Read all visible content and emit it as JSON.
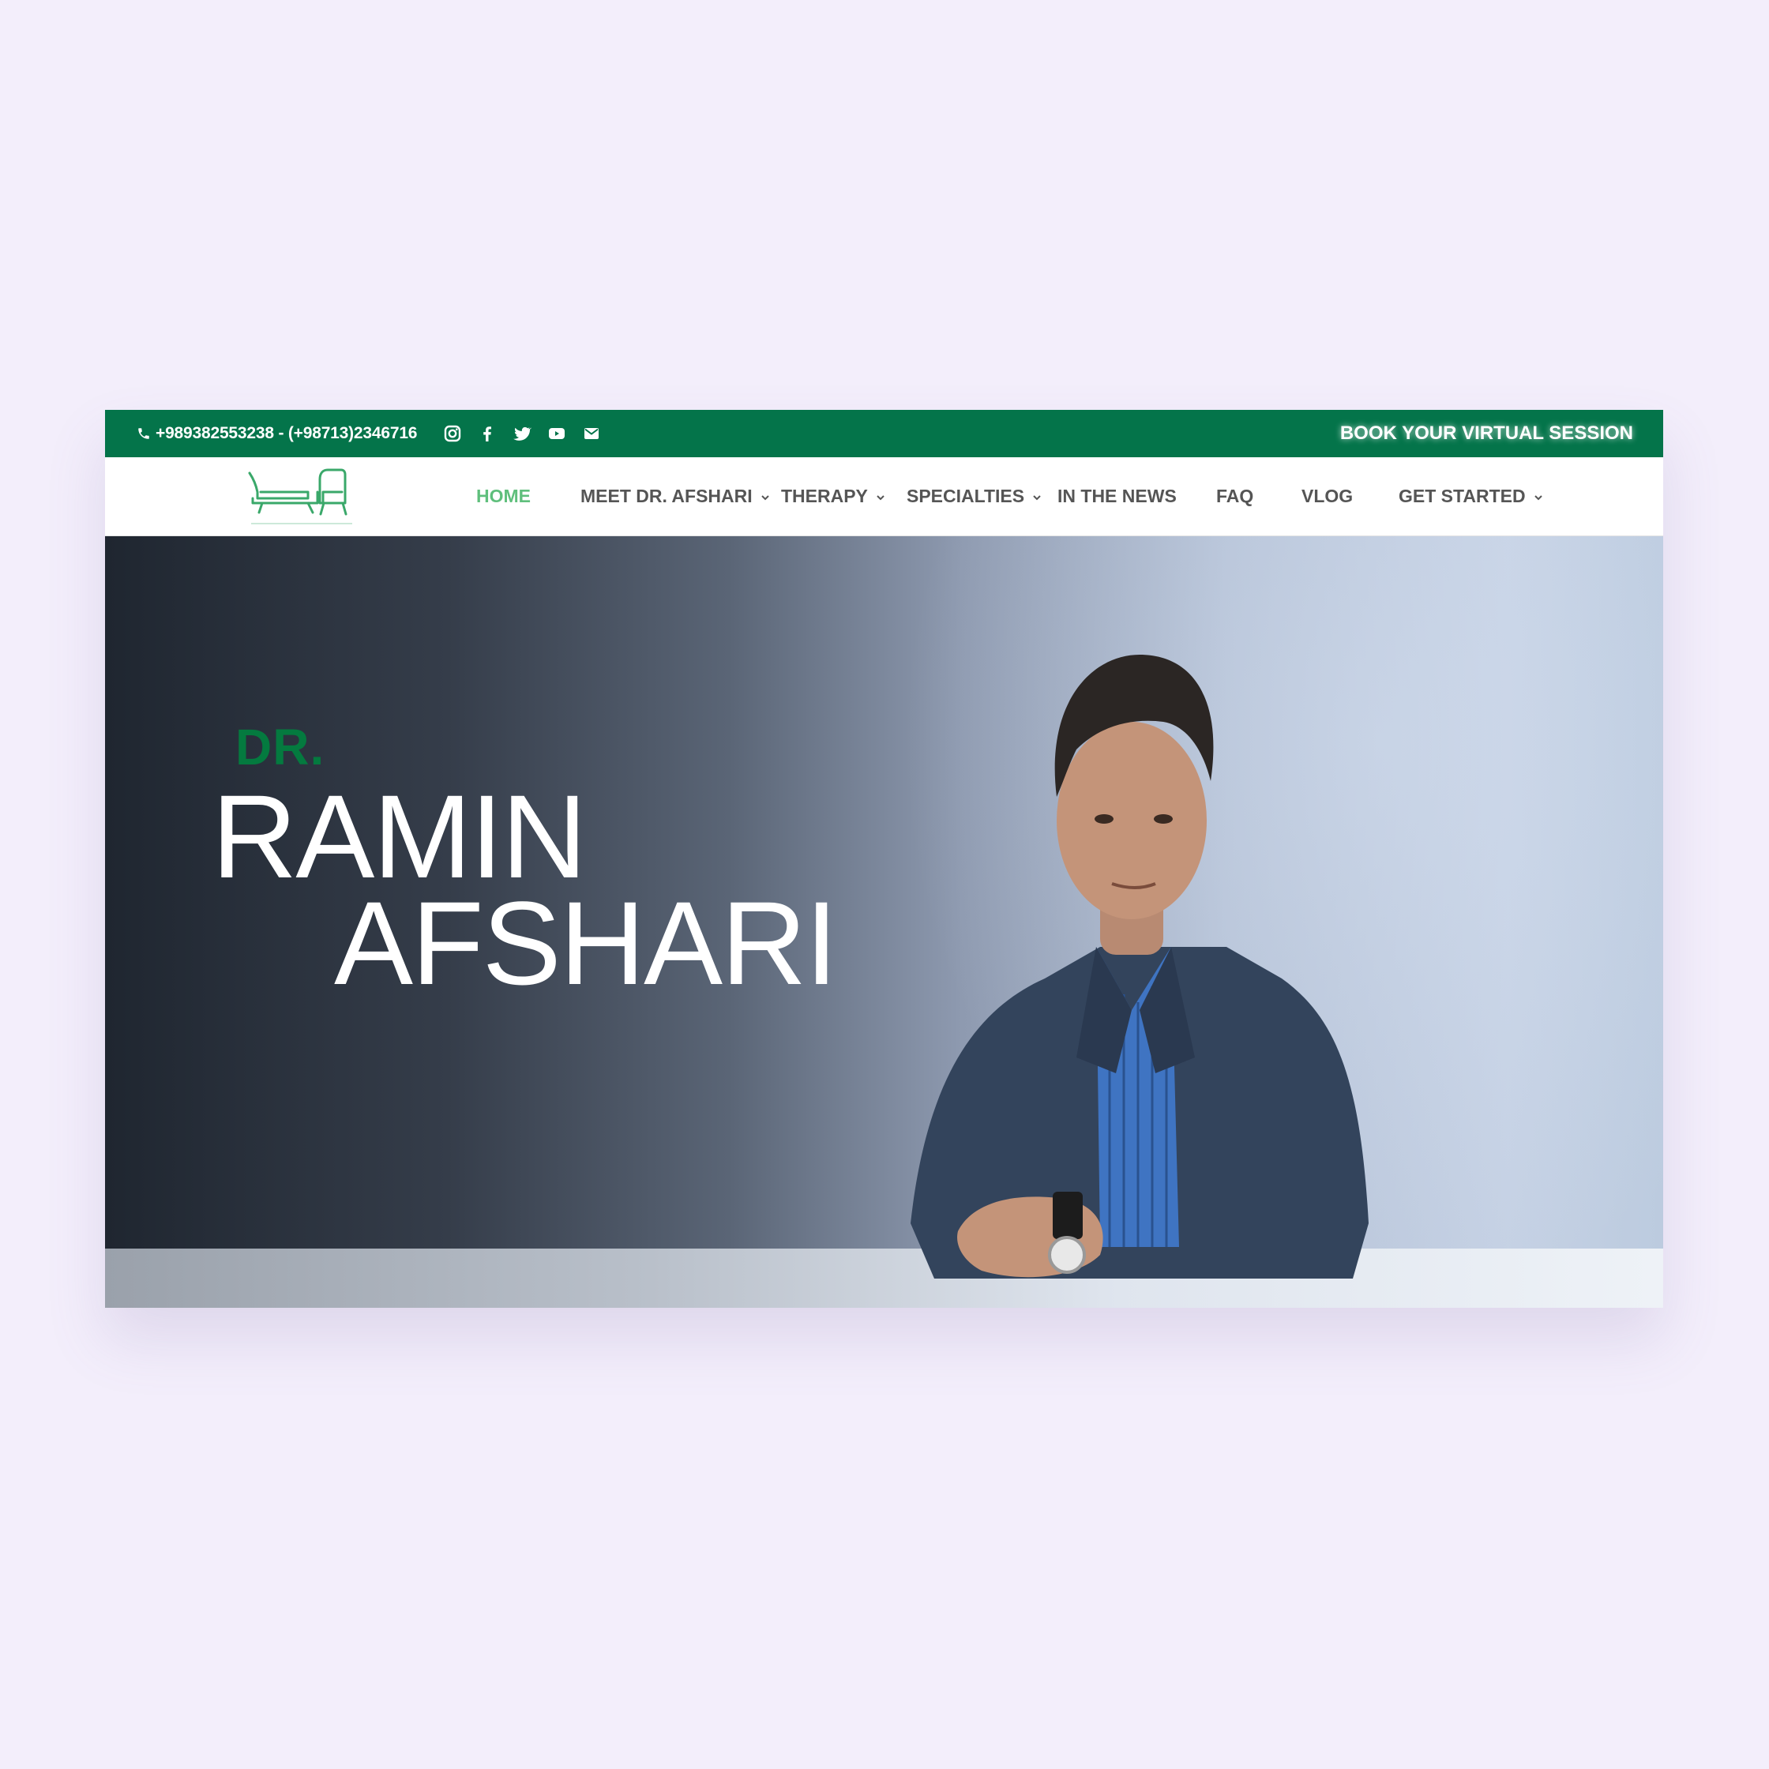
{
  "topbar": {
    "phone": "+989382553238 - (+98713)2346716",
    "book_session": "BOOK YOUR VIRTUAL SESSION",
    "social_icons": [
      "instagram-icon",
      "facebook-icon",
      "twitter-icon",
      "youtube-icon",
      "mail-icon"
    ]
  },
  "nav": {
    "items": [
      {
        "label": "HOME",
        "active": true,
        "dropdown": false
      },
      {
        "label": "MEET DR. AFSHARI",
        "active": false,
        "dropdown": true
      },
      {
        "label": "THERAPY",
        "active": false,
        "dropdown": true
      },
      {
        "label": "SPECIALTIES",
        "active": false,
        "dropdown": true
      },
      {
        "label": "IN THE NEWS",
        "active": false,
        "dropdown": false
      },
      {
        "label": "FAQ",
        "active": false,
        "dropdown": false
      },
      {
        "label": "VLOG",
        "active": false,
        "dropdown": false
      },
      {
        "label": "GET STARTED",
        "active": false,
        "dropdown": true
      }
    ]
  },
  "hero": {
    "prefix": "DR.",
    "first_name": "RAMIN",
    "last_name": "AFSHARI"
  },
  "colors": {
    "brand_green": "#04744a",
    "active_nav": "#5fbf7c",
    "page_background": "#f3eefb"
  }
}
